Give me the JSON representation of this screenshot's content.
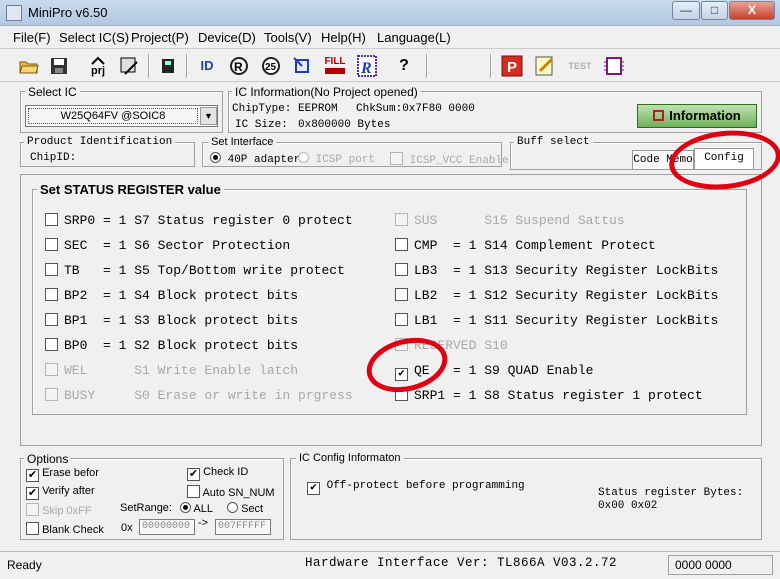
{
  "window": {
    "title": "MiniPro v6.50",
    "minimize": "—",
    "maximize": "□",
    "close": "X"
  },
  "menu": [
    "File(F)",
    "Select IC(S)",
    "Project(P)",
    "Device(D)",
    "Tools(V)",
    "Help(H)",
    "Language(L)"
  ],
  "toolbar": {
    "prj_label": "prj",
    "read_id_label": "ID",
    "fill_label": "FILL",
    "help_label": "?",
    "test_label": "TEST"
  },
  "select_ic": {
    "title": "Select IC",
    "value": "W25Q64FV @SOIC8",
    "dropdown_arrow": "▼"
  },
  "ic_info": {
    "title": "IC Information(No Project opened)",
    "chip_type": "ChipType:  EEPROM",
    "checksum": "ChkSum:0x7F80 0000",
    "ic_size_label": "IC Size:",
    "ic_size_value": "0x800000 Bytes",
    "information_button": "Information"
  },
  "product_id": {
    "title": "Product Identification",
    "chip_id_label": "ChipID:"
  },
  "interface": {
    "title": "Set Interface",
    "option1": "40P adapter",
    "option2": "ICSP port",
    "icsp_vcc": "ICSP_VCC Enable"
  },
  "buff_select": {
    "title": "Buff select",
    "tab_code": "Code Memo",
    "tab_config": "Config"
  },
  "status_register": {
    "title": "Set STATUS REGISTER value",
    "left": [
      {
        "text": "SRP0 = 1 S7 Status register 0 protect",
        "checked": false,
        "disabled": false
      },
      {
        "text": "SEC  = 1 S6 Sector Protection",
        "checked": false,
        "disabled": false
      },
      {
        "text": "TB   = 1 S5 Top/Bottom write protect",
        "checked": false,
        "disabled": false
      },
      {
        "text": "BP2  = 1 S4 Block protect bits",
        "checked": false,
        "disabled": false
      },
      {
        "text": "BP1  = 1 S3 Block protect bits",
        "checked": false,
        "disabled": false
      },
      {
        "text": "BP0  = 1 S2 Block protect bits",
        "checked": false,
        "disabled": false
      },
      {
        "text": "WEL      S1 Write Enable latch",
        "checked": false,
        "disabled": true
      },
      {
        "text": "BUSY     S0 Erase or write in prgress",
        "checked": false,
        "disabled": true
      }
    ],
    "right": [
      {
        "text": "SUS      S15 Suspend Sattus",
        "checked": false,
        "disabled": true
      },
      {
        "text": "CMP  = 1 S14 Complement Protect",
        "checked": false,
        "disabled": false
      },
      {
        "text": "LB3  = 1 S13 Security Register LockBits",
        "checked": false,
        "disabled": false
      },
      {
        "text": "LB2  = 1 S12 Security Register LockBits",
        "checked": false,
        "disabled": false
      },
      {
        "text": "LB1  = 1 S11 Security Register LockBits",
        "checked": false,
        "disabled": false
      },
      {
        "text": "RESERVED S10",
        "checked": false,
        "disabled": true
      },
      {
        "text": "QE   = 1 S9 QUAD Enable",
        "checked": true,
        "disabled": false
      },
      {
        "text": "SRP1 = 1 S8 Status register 1 protect",
        "checked": false,
        "disabled": false
      }
    ]
  },
  "options": {
    "title": "Options",
    "erase_before": "Erase befor",
    "check_id": "Check ID",
    "verify_after": "Verify after",
    "auto_sn": "Auto SN_NUM",
    "skip_ff": "Skip 0xFF",
    "set_range": "SetRange:",
    "range_all": "ALL",
    "range_sect": "Sect",
    "blank_check": "Blank Check",
    "ox_label": "0x",
    "range_start": "00000000",
    "range_arrow": "->",
    "range_end": "007FFFFF"
  },
  "config_info": {
    "title": "IC Config Informaton",
    "off_protect": "Off-protect before programming",
    "sr_bytes_label": "Status register Bytes:",
    "sr_bytes_value": "0x00 0x02"
  },
  "status_bar": {
    "ready": "Ready",
    "hw_version": "Hardware Interface Ver: TL866A V03.2.72",
    "counter": "0000 0000"
  },
  "colors": {
    "annotation_red": "#e00010",
    "info_button_green": "#6fb15b"
  }
}
